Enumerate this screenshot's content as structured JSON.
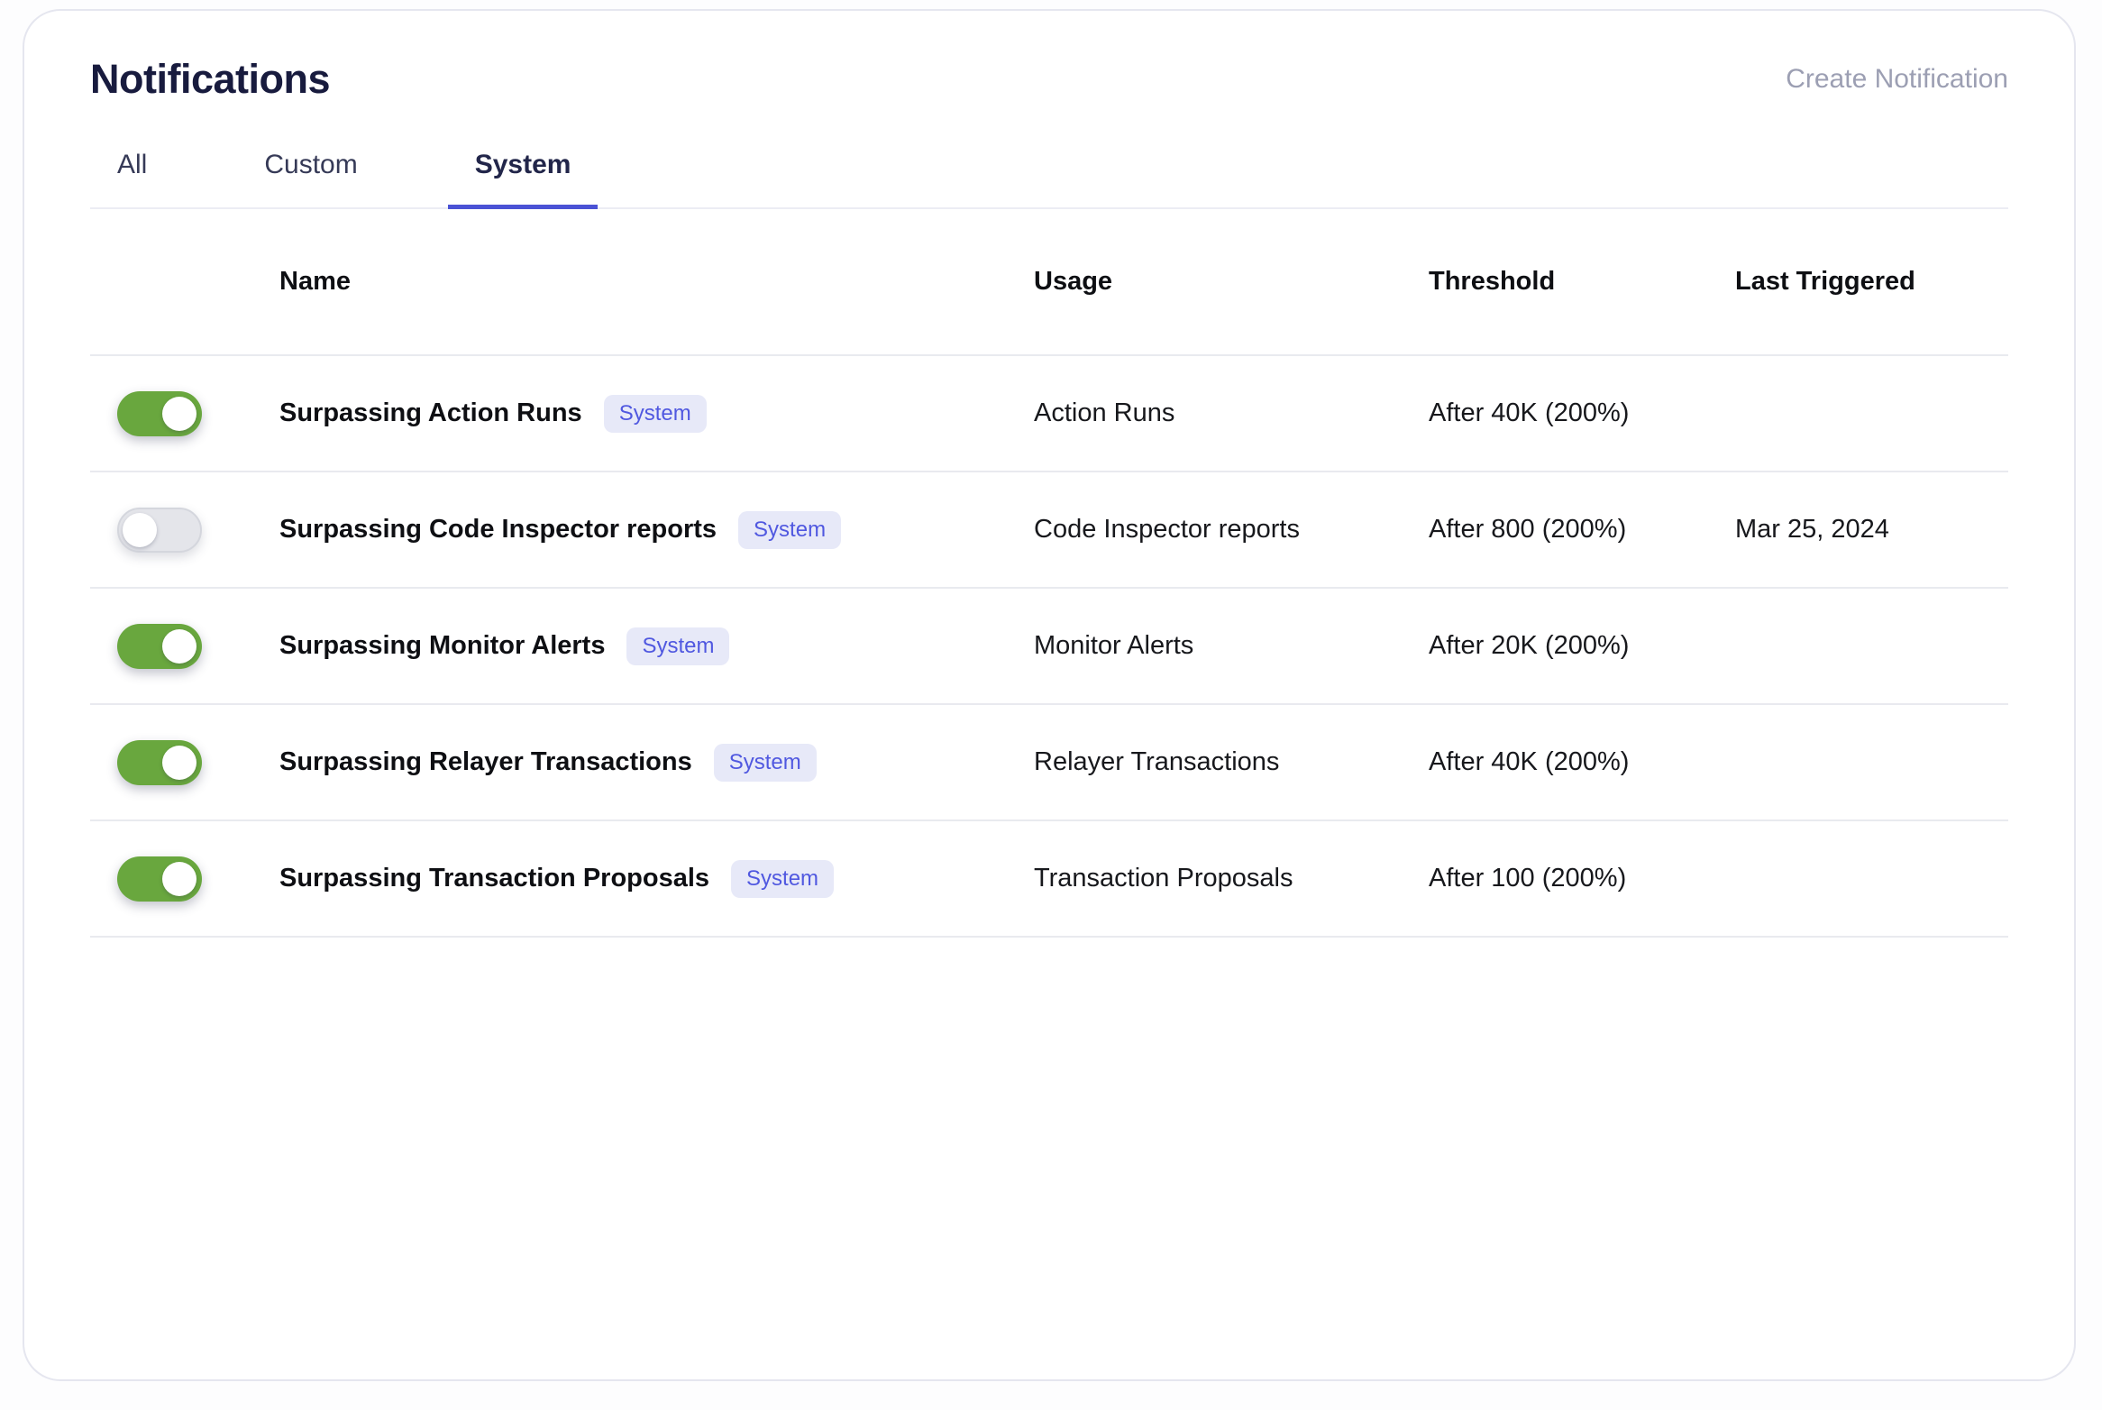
{
  "page": {
    "title": "Notifications",
    "create_button_label": "Create Notification"
  },
  "tabs": [
    {
      "label": "All",
      "active": false
    },
    {
      "label": "Custom",
      "active": false
    },
    {
      "label": "System",
      "active": true
    }
  ],
  "table": {
    "columns": [
      "Name",
      "Usage",
      "Threshold",
      "Last Triggered"
    ],
    "rows": [
      {
        "enabled": true,
        "name": "Surpassing Action Runs",
        "badge": "System",
        "usage": "Action Runs",
        "threshold": "After 40K (200%)",
        "last_triggered": ""
      },
      {
        "enabled": false,
        "name": "Surpassing Code Inspector reports",
        "badge": "System",
        "usage": "Code Inspector reports",
        "threshold": "After 800 (200%)",
        "last_triggered": "Mar 25, 2024"
      },
      {
        "enabled": true,
        "name": "Surpassing Monitor Alerts",
        "badge": "System",
        "usage": "Monitor Alerts",
        "threshold": "After 20K (200%)",
        "last_triggered": ""
      },
      {
        "enabled": true,
        "name": "Surpassing Relayer Transactions",
        "badge": "System",
        "usage": "Relayer Transactions",
        "threshold": "After 40K (200%)",
        "last_triggered": ""
      },
      {
        "enabled": true,
        "name": "Surpassing Transaction Proposals",
        "badge": "System",
        "usage": "Transaction Proposals",
        "threshold": "After 100 (200%)",
        "last_triggered": ""
      }
    ]
  },
  "colors": {
    "accent_underline": "#4A52D5",
    "toggle_on": "#69A73E",
    "toggle_off_track": "#E4E5EA",
    "badge_bg": "#E7E9F8",
    "badge_text": "#5058E0",
    "title_text": "#181B3E",
    "muted_text": "#9C9FB3",
    "card_border": "#E5E6EF"
  }
}
